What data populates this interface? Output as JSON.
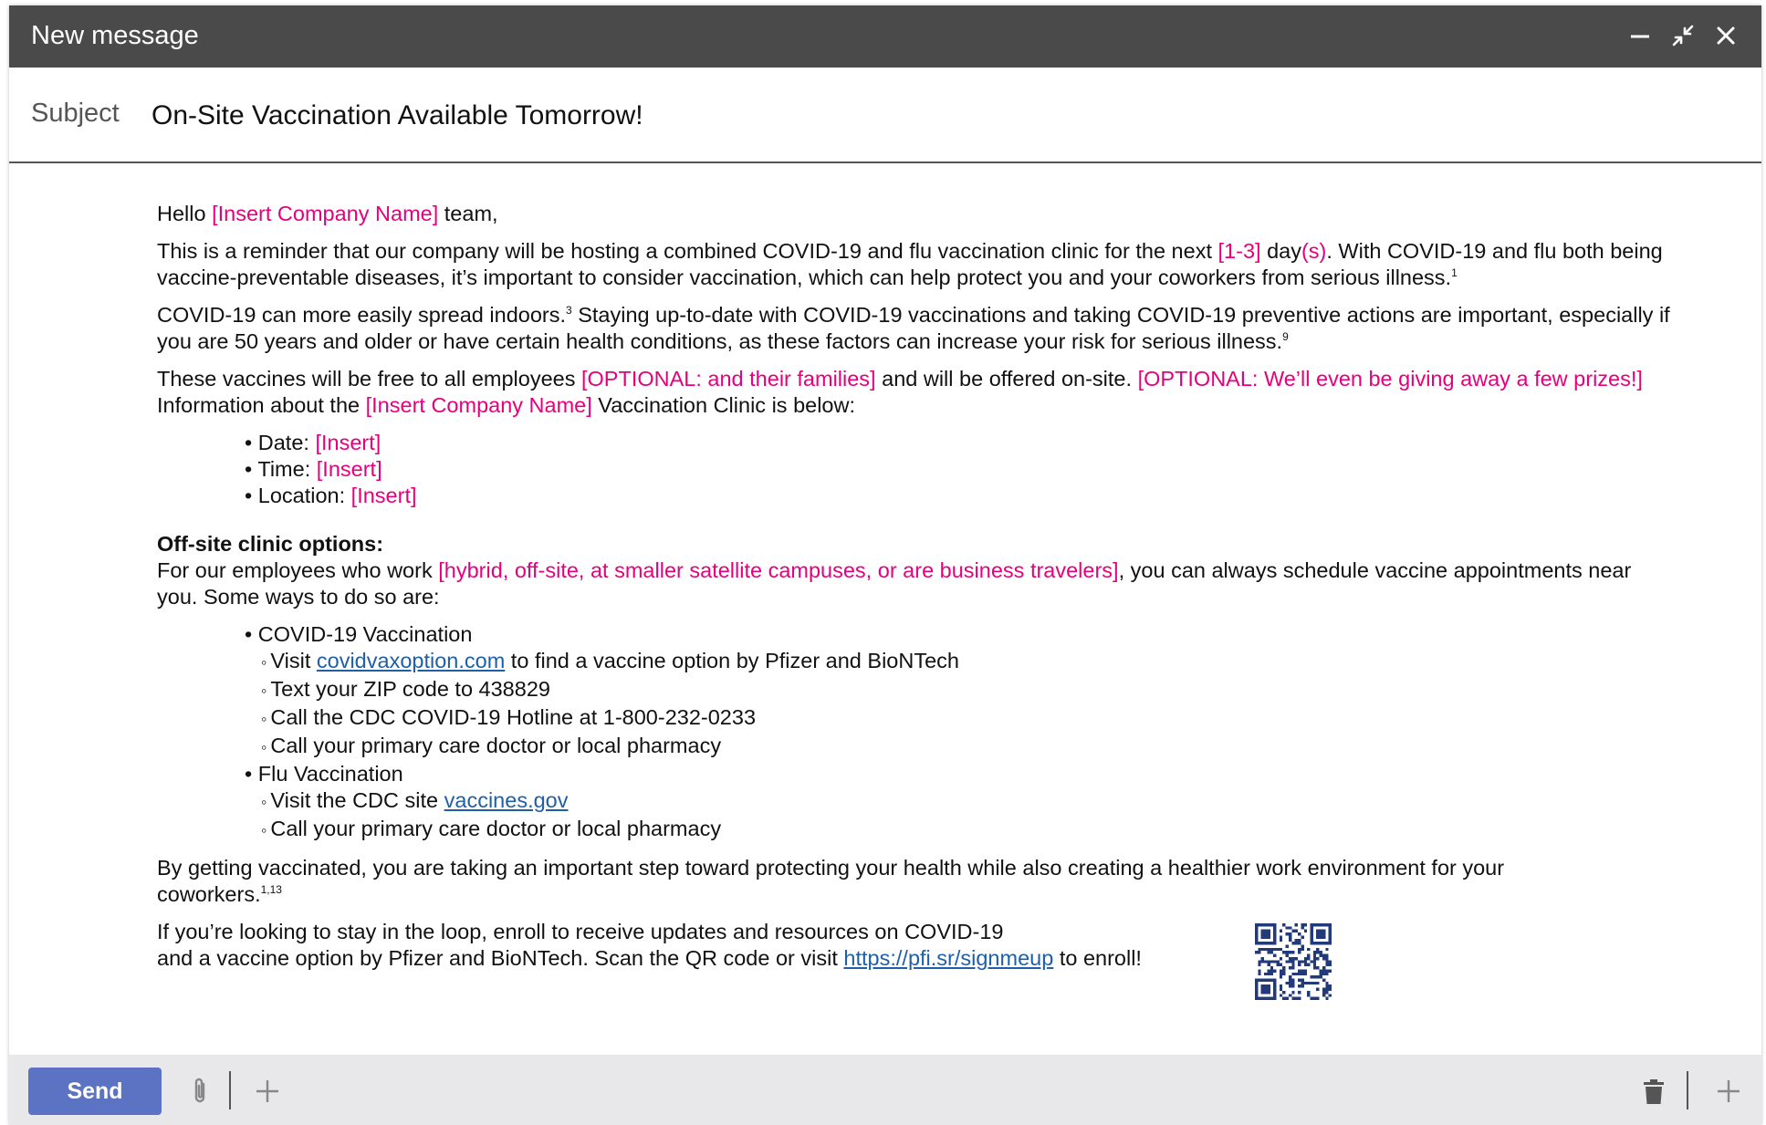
{
  "window": {
    "title": "New message",
    "controls": [
      "minimize-icon",
      "collapse-icon",
      "close-icon"
    ]
  },
  "subject": {
    "label": "Subject",
    "value": "On-Site Vaccination Available Tomorrow!"
  },
  "body": {
    "greeting": {
      "prefix": "Hello ",
      "placeholder": "[Insert Company Name]",
      "suffix": " team,"
    },
    "para1": {
      "t1": "This is a reminder that our company will be hosting a combined COVID-19 and flu vaccination clinic for the next ",
      "ph1": "[1-3]",
      "t2": " day",
      "ph2": "(s)",
      "t3": ".  With COVID-19 and flu both being vaccine-preventable diseases, it’s important to consider vaccination, which can help protect you and your coworkers from serious illness.",
      "sup": "1"
    },
    "para2": {
      "t1": "COVID-19 can more easily spread indoors.",
      "sup1": "3",
      "t2": " Staying up-to-date with COVID-19 vaccinations and taking COVID-19 preventive actions are important, especially if you are 50 years and older or have certain health conditions, as these factors can increase your risk for serious illness.",
      "sup2": "9"
    },
    "para3": {
      "t1": "These vaccines will be free to all employees ",
      "ph1": "[OPTIONAL: and their families]",
      "t2": " and will be offered on-site. ",
      "ph2": "[OPTIONAL: We’ll even be giving away a few prizes!]",
      "t3": " Information about the ",
      "ph3": "[Insert Company Name]",
      "t4": " Vaccination Clinic is below:"
    },
    "details": [
      {
        "label": "Date: ",
        "value": "[Insert]"
      },
      {
        "label": "Time: ",
        "value": "[Insert]"
      },
      {
        "label": "Location: ",
        "value": "[Insert]"
      }
    ],
    "offsite": {
      "heading": "Off-site clinic options:",
      "t1": "For our employees who work ",
      "ph1": "[hybrid, off-site, at smaller satellite campuses, or are business travelers]",
      "t2": ", you can always schedule vaccine appointments near you. Some ways to do so are:"
    },
    "covid": {
      "title": "COVID-19 Vaccination",
      "item1_pre": "Visit ",
      "item1_link": "covidvaxoption.com",
      "item1_post": " to find a vaccine option by Pfizer and BioNTech",
      "item2": "Text your ZIP code to 438829",
      "item3": "Call the CDC COVID-19 Hotline at 1-800-232-0233",
      "item4": "Call your primary care doctor or local pharmacy"
    },
    "flu": {
      "title": "Flu Vaccination",
      "item1_pre": "Visit the CDC site ",
      "item1_link": "vaccines.gov",
      "item2": "Call your primary care doctor or local pharmacy"
    },
    "para4": {
      "t1": "By getting vaccinated, you are taking an important step toward protecting your health while also creating a healthier work environment for your coworkers.",
      "sup": "1,13"
    },
    "para5": {
      "line1": "If you’re looking to stay in the loop, enroll to receive updates and resources on COVID-19",
      "t2": "and a vaccine option by Pfizer and BioNTech. Scan the QR code or visit ",
      "link": "https://pfi.sr/signmeup",
      "t3": " to enroll!"
    }
  },
  "footer": {
    "send_label": "Send",
    "left_icons": [
      "paperclip-icon",
      "plus-icon"
    ],
    "right_icons": [
      "trash-icon",
      "plus-icon"
    ]
  },
  "colors": {
    "titlebar": "#4a4a4a",
    "placeholder": "#e6007e",
    "link": "#1f5fa8",
    "send": "#5b73c2",
    "footer": "#e8e8ea"
  }
}
